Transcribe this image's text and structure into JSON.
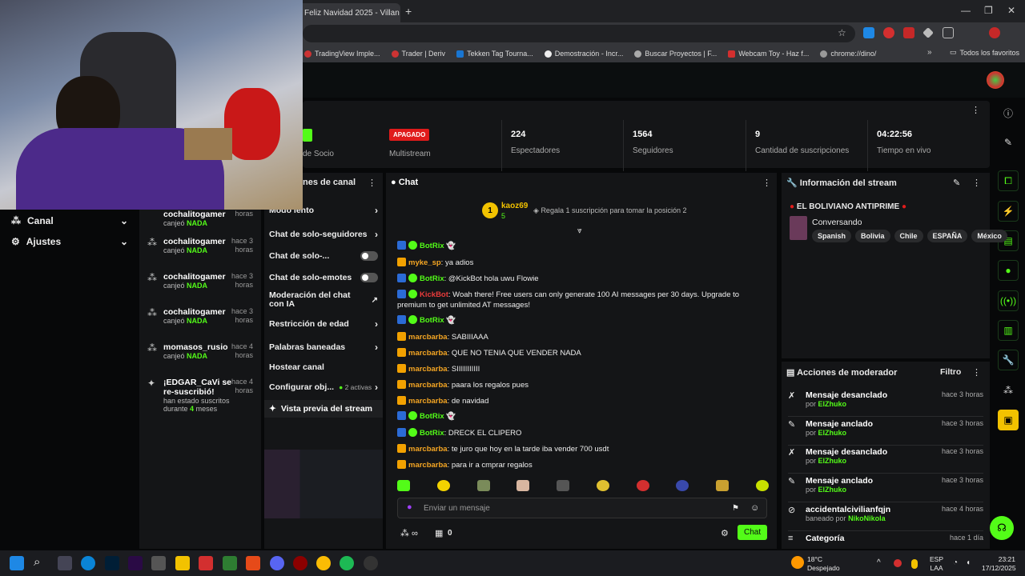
{
  "browser": {
    "tab_title": "Feliz Navidad 2025 - Villan",
    "bookmarks": [
      "TradingView Imple...",
      "Trader | Deriv",
      "Tekken Tag Tourna...",
      "Demostración - Incr...",
      "Buscar Proyectos | F...",
      "Webcam Toy - Haz f...",
      "chrome://dino/"
    ],
    "all_favorites": "Todos los favoritos"
  },
  "stats": {
    "partner_label": "de Socio",
    "multistream_badge": "APAGADO",
    "multistream_label": "Multistream",
    "viewers_value": "224",
    "viewers_label": "Espectadores",
    "followers_value": "1564",
    "followers_label": "Seguidores",
    "subs_value": "9",
    "subs_label": "Cantidad de suscripciones",
    "uptime_value": "04:22:56",
    "uptime_label": "Tiempo en vivo"
  },
  "sidebar": {
    "canal": "Canal",
    "ajustes": "Ajustes"
  },
  "activity": [
    {
      "name": "canjeó",
      "reward": "NADA",
      "user": "cochalitogamer",
      "time": "horas",
      "partial": true
    },
    {
      "name": "cochalitogamer",
      "action": "canjeó",
      "reward": "NADA",
      "time": "hace 3 horas"
    },
    {
      "name": "cochalitogamer",
      "action": "canjeó",
      "reward": "NADA",
      "time": "hace 3 horas"
    },
    {
      "name": "cochalitogamer",
      "action": "canjeó",
      "reward": "NADA",
      "time": "hace 3 horas"
    },
    {
      "name": "momasos_rusio",
      "action": "canjeó",
      "reward": "NADA",
      "time": "hace 4 horas"
    },
    {
      "name": "¡EDGAR_CaVi se re-suscribió!",
      "action": "han estado suscritos durante",
      "months": "4",
      "months_label": "meses",
      "time": "hace 4 horas"
    }
  ],
  "settings": {
    "title_partial": "nes de canal",
    "items": [
      "Modo lento",
      "Chat de solo-seguidores",
      "Chat de solo-...",
      "Chat de solo-emotes",
      "Moderación del chat con IA",
      "Restricción de edad",
      "Palabras baneadas",
      "Hostear canal",
      "Configurar obj..."
    ],
    "active_count": "2 activas",
    "preview": "Vista previa del stream"
  },
  "chat": {
    "title": "Chat",
    "top_gifter": "kaoz69",
    "top_gifter_count": "5",
    "top_rank": "1",
    "gift_prompt": "Regala 1 suscripción para tomar la posición 2",
    "messages": [
      {
        "user": "BotRix",
        "cls": "un-green",
        "text": "",
        "badges": "mv"
      },
      {
        "user": "myke_sp",
        "cls": "un-orange",
        "text": ": ya adios",
        "badges": "v"
      },
      {
        "user": "BotRix",
        "cls": "un-green",
        "text": ": @KickBot hola uwu Flowie",
        "badges": "mv"
      },
      {
        "user": "KickBot",
        "cls": "un-red",
        "text": ": Woah there! Free users can only generate 100 AI messages per 30 days. Upgrade to premium to get unlimited AT messages!",
        "badges": "mv"
      },
      {
        "user": "BotRix",
        "cls": "un-green",
        "text": "",
        "badges": "mv"
      },
      {
        "user": "marcbarba",
        "cls": "un-orange",
        "text": ": SABIIIAAA",
        "badges": "v"
      },
      {
        "user": "marcbarba",
        "cls": "un-orange",
        "text": ": QUE NO TENIA QUE VENDER NADA",
        "badges": "v"
      },
      {
        "user": "marcbarba",
        "cls": "un-orange",
        "text": ": SIIIIIIIIIII",
        "badges": "v"
      },
      {
        "user": "marcbarba",
        "cls": "un-orange",
        "text": ": paara los regalos pues",
        "badges": "v"
      },
      {
        "user": "marcbarba",
        "cls": "un-orange",
        "text": ": de navidad",
        "badges": "v"
      },
      {
        "user": "BotRix",
        "cls": "un-green",
        "text": "",
        "badges": "mv"
      },
      {
        "user": "BotRix",
        "cls": "un-green",
        "text": ": DRECK EL CLIPERO",
        "badges": "mv"
      },
      {
        "user": "marcbarba",
        "cls": "un-orange",
        "text": ": te juro que hoy en la tarde iba vender 700 usdt",
        "badges": "v"
      },
      {
        "user": "marcbarba",
        "cls": "un-orange",
        "text": ": para ir a cmprar regalos",
        "badges": "v"
      }
    ],
    "input_placeholder": "Enviar un mensaje",
    "points": "0",
    "send": "Chat"
  },
  "info": {
    "title": "Información del stream",
    "stream_title": "EL BOLIVIANO ANTIPRIME",
    "category": "Conversando",
    "tags": [
      "Spanish",
      "Bolivia",
      "Chile",
      "ESPAÑA",
      "México"
    ]
  },
  "mod_actions": {
    "title": "Acciones de moderador",
    "filter": "Filtro",
    "items": [
      {
        "action": "Mensaje desanclado",
        "by": "por",
        "user": "ElZhuko",
        "time": "hace 3 horas"
      },
      {
        "action": "Mensaje anclado",
        "by": "por",
        "user": "ElZhuko",
        "time": "hace 3 horas"
      },
      {
        "action": "Mensaje desanclado",
        "by": "por",
        "user": "ElZhuko",
        "time": "hace 3 horas"
      },
      {
        "action": "Mensaje anclado",
        "by": "por",
        "user": "ElZhuko",
        "time": "hace 3 horas"
      },
      {
        "action": "accidentalcivilianfqjn",
        "by": "baneado por",
        "user": "NikoNikola",
        "time": "hace 4 horas"
      },
      {
        "action": "Categoría",
        "by": "",
        "user": "",
        "time": "hace 1 día"
      }
    ]
  },
  "taskbar": {
    "weather_temp": "18°C",
    "weather_desc": "Despejado",
    "lang": "ESP",
    "lang2": "LAA",
    "time": "23:21",
    "date": "17/12/2025"
  }
}
